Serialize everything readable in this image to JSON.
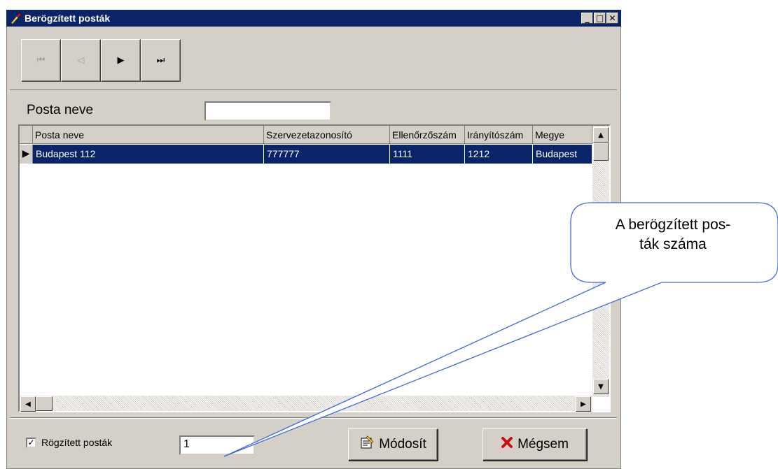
{
  "window": {
    "title": "Berögzített posták",
    "minimize_glyph": "_",
    "maximize_glyph": "□",
    "close_glyph": "✕"
  },
  "navigator": {
    "first_glyph": "⏮",
    "prev_glyph": "◁",
    "next_glyph": "▶",
    "last_glyph": "⏭"
  },
  "search": {
    "label": "Posta neve",
    "value": ""
  },
  "grid": {
    "columns": [
      "Posta neve",
      "Szervezetazonosító",
      "Ellenőrzőszám",
      "Irányítószám",
      "Megye"
    ],
    "rows": [
      [
        "Budapest 112",
        "777777",
        "1111",
        "1212",
        "Budapest"
      ]
    ],
    "current_row_glyph": "▶"
  },
  "bottom": {
    "checkbox_label": "Rögzített posták",
    "checkbox_checked": true,
    "check_glyph": "✓",
    "count_value": "1",
    "modify_label": "Módosít",
    "cancel_label": "Mégsem"
  },
  "callout": {
    "line1": "A berögzített pos-",
    "line2": "ták száma"
  },
  "colors": {
    "title_bar": "#0a246a",
    "selection": "#0a246a",
    "face": "#d4d0c8",
    "callout_stroke": "#4169e1",
    "cancel_icon": "#cc1010"
  }
}
